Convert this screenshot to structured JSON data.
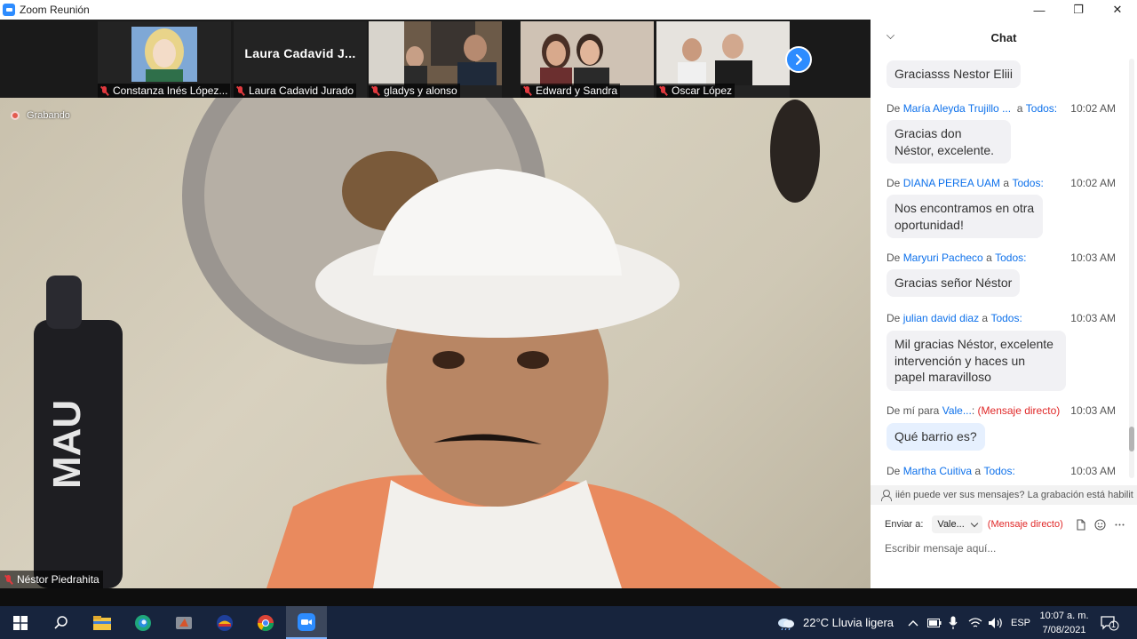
{
  "window": {
    "title": "Zoom Reunión",
    "minimize": "—",
    "restore": "❐",
    "close": "✕"
  },
  "thumbnails": [
    {
      "name": "Constanza Inés López..."
    },
    {
      "name": "Laura Cadavid Jurado",
      "display_name": "Laura  Cadavid  J..."
    },
    {
      "name": "gladys y alonso"
    },
    {
      "name": "Edward y Sandra"
    },
    {
      "name": "Oscar López"
    }
  ],
  "main_video": {
    "recording_label": "Grabando",
    "speaker_name": "Néstor Piedrahita"
  },
  "chat": {
    "title": "Chat",
    "messages": [
      {
        "text": "Graciasss Nestor Eliii"
      },
      {
        "from_prefix": "De",
        "sender": "María Aleyda Trujillo ...",
        "to_prefix": "a",
        "recipient": "Todos:",
        "time": "10:02 AM",
        "text": "Gracias don Néstor, excelente."
      },
      {
        "from_prefix": "De",
        "sender": "DIANA PEREA UAM",
        "to_prefix": "a",
        "recipient": "Todos:",
        "time": "10:02 AM",
        "text": "Nos encontramos en otra oportunidad!"
      },
      {
        "from_prefix": "De",
        "sender": "Maryuri Pacheco",
        "to_prefix": "a",
        "recipient": "Todos:",
        "time": "10:03 AM",
        "text": "Gracias señor Néstor"
      },
      {
        "from_prefix": "De",
        "sender": "julian david diaz",
        "to_prefix": "a",
        "recipient": "Todos:",
        "time": "10:03 AM",
        "text": "Mil gracias Néstor, excelente intervención y haces un papel maravilloso"
      },
      {
        "from_prefix": "De mí para",
        "sender": "Vale...",
        "to_prefix": ":",
        "recipient": "(Mensaje directo)",
        "time": "10:03 AM",
        "text": "Qué barrio es?"
      },
      {
        "from_prefix": "De",
        "sender": "Martha Cuitiva",
        "to_prefix": "a",
        "recipient": "Todos:",
        "time": "10:03 AM"
      }
    ],
    "privacy_notice": "iién puede ver sus mensajes? La grabación está habilit",
    "send_to_label": "Enviar a:",
    "send_to_value": "Vale...",
    "direct_label": "(Mensaje directo)",
    "input_placeholder": "Escribir mensaje aquí..."
  },
  "taskbar": {
    "weather": "22°C  Lluvia ligera",
    "language": "ESP",
    "time": "10:07 a. m.",
    "date": "7/08/2021",
    "notifications_count": "1"
  },
  "colors": {
    "zoom_blue": "#2d8cff",
    "chat_link": "#0e71eb",
    "direct_red": "#e02828",
    "muted_red": "#e0393e",
    "taskbar_bg": "#17243d"
  }
}
